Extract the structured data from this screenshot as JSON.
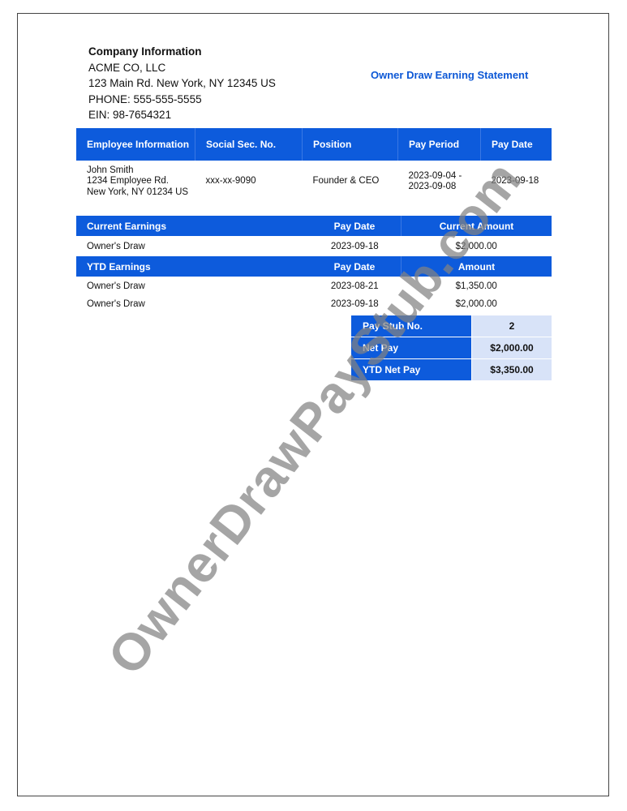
{
  "company": {
    "heading": "Company Information",
    "name": "ACME CO, LLC",
    "address": "123 Main Rd. New York, NY 12345 US",
    "phone": "PHONE: 555-555-5555",
    "ein": "EIN: 98-7654321"
  },
  "document_title": "Owner Draw Earning Statement",
  "employee_table": {
    "headers": [
      "Employee Information",
      "Social Sec. No.",
      "Position",
      "Pay Period",
      "Pay Date"
    ],
    "employee": {
      "name": "John Smith",
      "address_line1": "1234 Employee Rd.",
      "address_line2": "New York, NY 01234 US"
    },
    "ssn": "xxx-xx-9090",
    "position": "Founder & CEO",
    "pay_period_start": "2023-09-04 -",
    "pay_period_end": "2023-09-08",
    "pay_date": "2023-09-18"
  },
  "current_earnings": {
    "headers": [
      "Current Earnings",
      "Pay Date",
      "Current Amount"
    ],
    "rows": [
      {
        "description": "Owner's Draw",
        "pay_date": "2023-09-18",
        "amount": "$2,000.00"
      }
    ]
  },
  "ytd_earnings": {
    "headers": [
      "YTD Earnings",
      "Pay Date",
      "Amount"
    ],
    "rows": [
      {
        "description": "Owner's Draw",
        "pay_date": "2023-08-21",
        "amount": "$1,350.00"
      },
      {
        "description": "Owner's Draw",
        "pay_date": "2023-09-18",
        "amount": "$2,000.00"
      }
    ]
  },
  "summary": [
    {
      "label": "Pay Stub No.",
      "value": "2"
    },
    {
      "label": "Net Pay",
      "value": "$2,000.00"
    },
    {
      "label": "YTD Net Pay",
      "value": "$3,350.00"
    }
  ],
  "watermark": "OwnerDrawPayStub.com",
  "colors": {
    "accent_blue": "#0d5bdc",
    "title_blue": "#0d58d6",
    "summary_value_bg": "#d8e3f8"
  }
}
